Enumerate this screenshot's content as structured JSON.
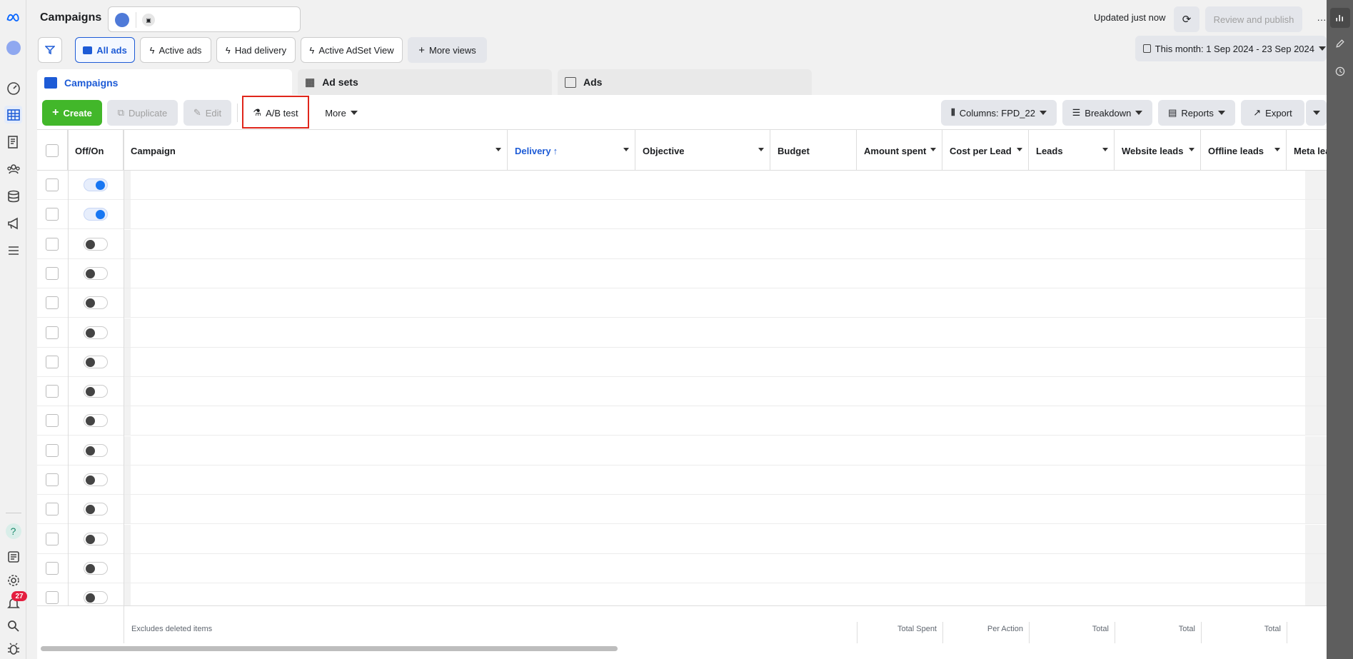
{
  "header": {
    "title": "Campaigns",
    "updated": "Updated just now",
    "review_publish": "Review and publish",
    "more_dots": "···"
  },
  "views": {
    "all_ads": "All ads",
    "active_ads": "Active ads",
    "had_delivery": "Had delivery",
    "active_adset_view": "Active AdSet View",
    "more_views": "More views"
  },
  "date_range": "This month: 1 Sep 2024 - 23 Sep 2024",
  "tabs": {
    "campaigns": "Campaigns",
    "ad_sets": "Ad sets",
    "ads": "Ads"
  },
  "toolbar": {
    "create": "Create",
    "duplicate": "Duplicate",
    "edit": "Edit",
    "ab_test": "A/B test",
    "more": "More",
    "columns": "Columns: FPD_22",
    "breakdown": "Breakdown",
    "reports": "Reports",
    "export": "Export"
  },
  "columns": {
    "offon": "Off/On",
    "campaign": "Campaign",
    "delivery": "Delivery",
    "objective": "Objective",
    "budget": "Budget",
    "amount_spent": "Amount spent",
    "cost_per_lead": "Cost per Lead",
    "leads": "Leads",
    "website_leads": "Website leads",
    "offline_leads": "Offline leads",
    "meta_leads": "Meta lea"
  },
  "rows": [
    {
      "on": true
    },
    {
      "on": true
    },
    {
      "on": false
    },
    {
      "on": false
    },
    {
      "on": false
    },
    {
      "on": false
    },
    {
      "on": false
    },
    {
      "on": false
    },
    {
      "on": false
    },
    {
      "on": false
    },
    {
      "on": false
    },
    {
      "on": false
    },
    {
      "on": false
    },
    {
      "on": false
    },
    {
      "on": false
    }
  ],
  "footer": {
    "excludes": "Excludes deleted items",
    "total_spent": "Total Spent",
    "per_action": "Per Action",
    "total_leads": "Total",
    "total_website": "Total",
    "total_offline": "Total"
  },
  "notifications_count": "27",
  "colors": {
    "accent": "#1877f2",
    "create_green": "#42b72a",
    "highlight_red": "#e0261b"
  }
}
